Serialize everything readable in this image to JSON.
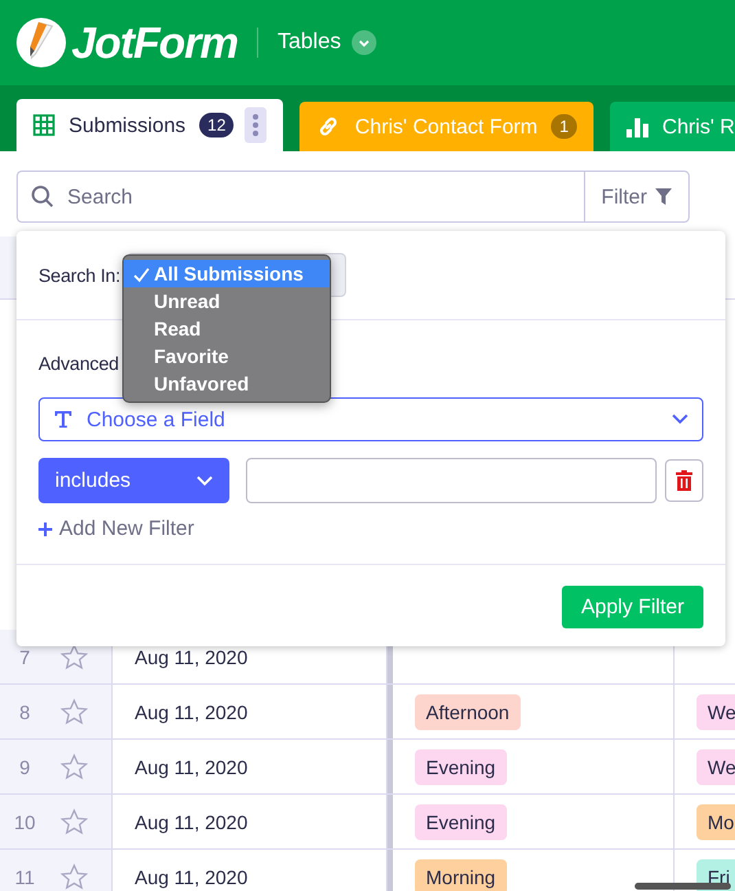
{
  "header": {
    "logo": "JotForm",
    "section": "Tables"
  },
  "tabs": [
    {
      "label": "Submissions",
      "badge": "12",
      "kind": "table",
      "selected": true
    },
    {
      "label": "Chris' Contact Form",
      "badge": "1",
      "kind": "form",
      "selected": false
    },
    {
      "label": "Chris' R",
      "kind": "report",
      "selected": false
    }
  ],
  "search": {
    "placeholder": "Search",
    "filter_button": "Filter"
  },
  "table": {
    "rows": [
      {
        "number": "7",
        "starred": false,
        "date": "Aug 11, 2020"
      },
      {
        "number": "8",
        "starred": false,
        "date": "Aug 11, 2020",
        "column_2": {
          "text": "Afternoon",
          "color": "#fdd5cc"
        },
        "column_3": {
          "text": "We",
          "color": "#fdd6f0"
        }
      },
      {
        "number": "9",
        "starred": false,
        "date": "Aug 11, 2020",
        "column_2": {
          "text": "Evening",
          "color": "#fdd6f0"
        },
        "column_3": {
          "text": "We",
          "color": "#fdd6f0"
        }
      },
      {
        "number": "10",
        "starred": false,
        "date": "Aug 11, 2020",
        "column_2": {
          "text": "Evening",
          "color": "#fdd6f0"
        },
        "column_3": {
          "text": "Mo",
          "color": "#fdd09e"
        }
      },
      {
        "number": "11",
        "starred": false,
        "date": "Aug 11, 2020",
        "column_2": {
          "text": "Morning",
          "color": "#fdd09e"
        },
        "column_3": {
          "text": "Fri",
          "color": "#b3f1e4"
        }
      }
    ]
  },
  "filter_panel": {
    "search_in_label": "Search In:",
    "search_in_options": [
      {
        "label": "All Submissions",
        "selected": true
      },
      {
        "label": "Unread",
        "selected": false
      },
      {
        "label": "Read",
        "selected": false
      },
      {
        "label": "Favorite",
        "selected": false
      },
      {
        "label": "Unfavored",
        "selected": false
      }
    ],
    "advanced_label": "Advanced",
    "field_placeholder": "Choose a Field",
    "operator": "includes",
    "add_filter": "Add New Filter",
    "apply_button": "Apply Filter"
  }
}
